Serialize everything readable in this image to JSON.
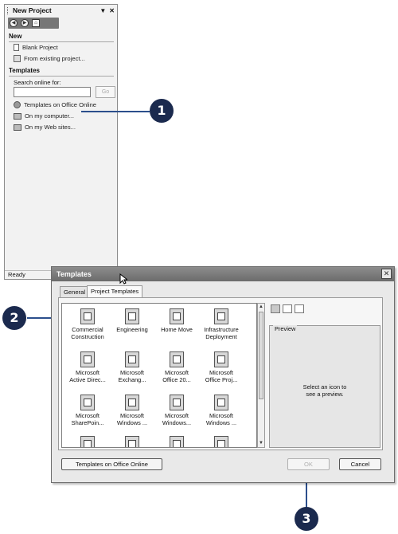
{
  "task_pane": {
    "title": "New Project",
    "section_new": {
      "heading": "New",
      "items": [
        {
          "label": "Blank Project",
          "icon": "blank-document-icon"
        },
        {
          "label": "From existing project...",
          "icon": "existing-project-icon"
        }
      ]
    },
    "section_templates": {
      "heading": "Templates",
      "search_label": "Search online for:",
      "search_value": "",
      "go_label": "Go",
      "items": [
        {
          "label": "Templates on Office Online",
          "icon": "globe-icon"
        },
        {
          "label": "On my computer...",
          "icon": "computer-icon"
        },
        {
          "label": "On my Web sites...",
          "icon": "web-sites-icon"
        }
      ]
    },
    "status": "Ready"
  },
  "callouts": [
    "1",
    "2",
    "3"
  ],
  "dialog": {
    "title": "Templates",
    "tabs": [
      "General",
      "Project Templates"
    ],
    "active_tab": "Project Templates",
    "templates": [
      [
        "Commercial",
        "Construction"
      ],
      [
        "Engineering"
      ],
      [
        "Home Move"
      ],
      [
        "Infrastructure",
        "Deployment"
      ],
      [
        "Microsoft",
        "Active Direc..."
      ],
      [
        "Microsoft",
        "Exchang..."
      ],
      [
        "Microsoft",
        "Office 20..."
      ],
      [
        "Microsoft",
        "Office Proj..."
      ],
      [
        "Microsoft",
        "SharePoin..."
      ],
      [
        "Microsoft",
        "Windows ..."
      ],
      [
        "Microsoft",
        "Windows..."
      ],
      [
        "Microsoft",
        "Windows ..."
      ]
    ],
    "preview_label": "Preview",
    "preview_message_line1": "Select an icon to",
    "preview_message_line2": "see a preview.",
    "buttons": {
      "online": "Templates on Office Online",
      "ok": "OK",
      "cancel": "Cancel"
    }
  }
}
